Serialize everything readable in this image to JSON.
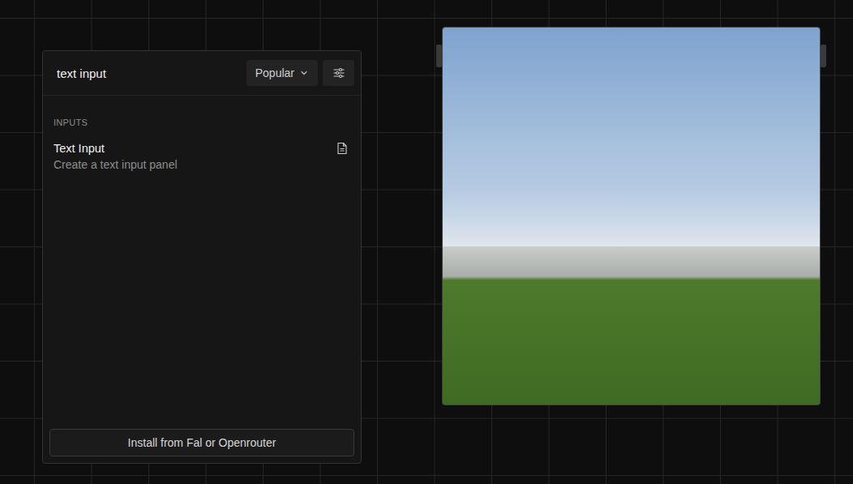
{
  "panel": {
    "search": "text input",
    "sort": "Popular",
    "section": "INPUTS",
    "items": [
      {
        "title": "Text Input",
        "description": "Create a text input panel"
      }
    ],
    "install_button": "Install from Fal or Openrouter"
  },
  "image_node": {
    "has_image": true
  }
}
